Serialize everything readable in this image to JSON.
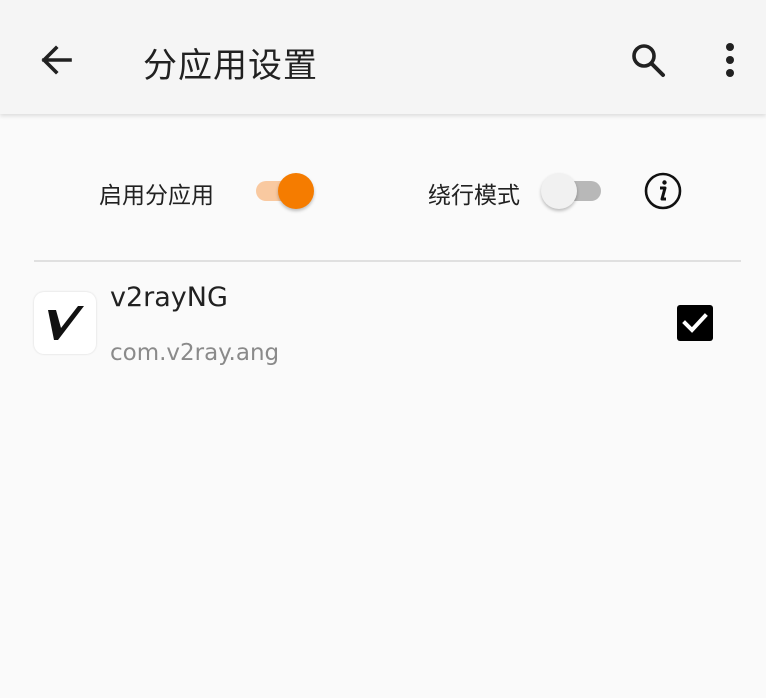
{
  "appbar": {
    "title": "分应用设置",
    "icons": {
      "back": "arrow-back-icon",
      "search": "search-icon",
      "more": "more-vert-icon"
    }
  },
  "controls": {
    "enable_label": "启用分应用",
    "enable_on": true,
    "bypass_label": "绕行模式",
    "bypass_on": false,
    "info_icon": "info-icon"
  },
  "apps": [
    {
      "name": "v2rayNG",
      "package": "com.v2ray.ang",
      "checked": true,
      "icon": "v2rayng-app-icon"
    }
  ],
  "colors": {
    "accent": "#f57c00",
    "accent_track": "#f9c9a0",
    "background": "#fafafa",
    "appbar": "#f5f5f5"
  }
}
